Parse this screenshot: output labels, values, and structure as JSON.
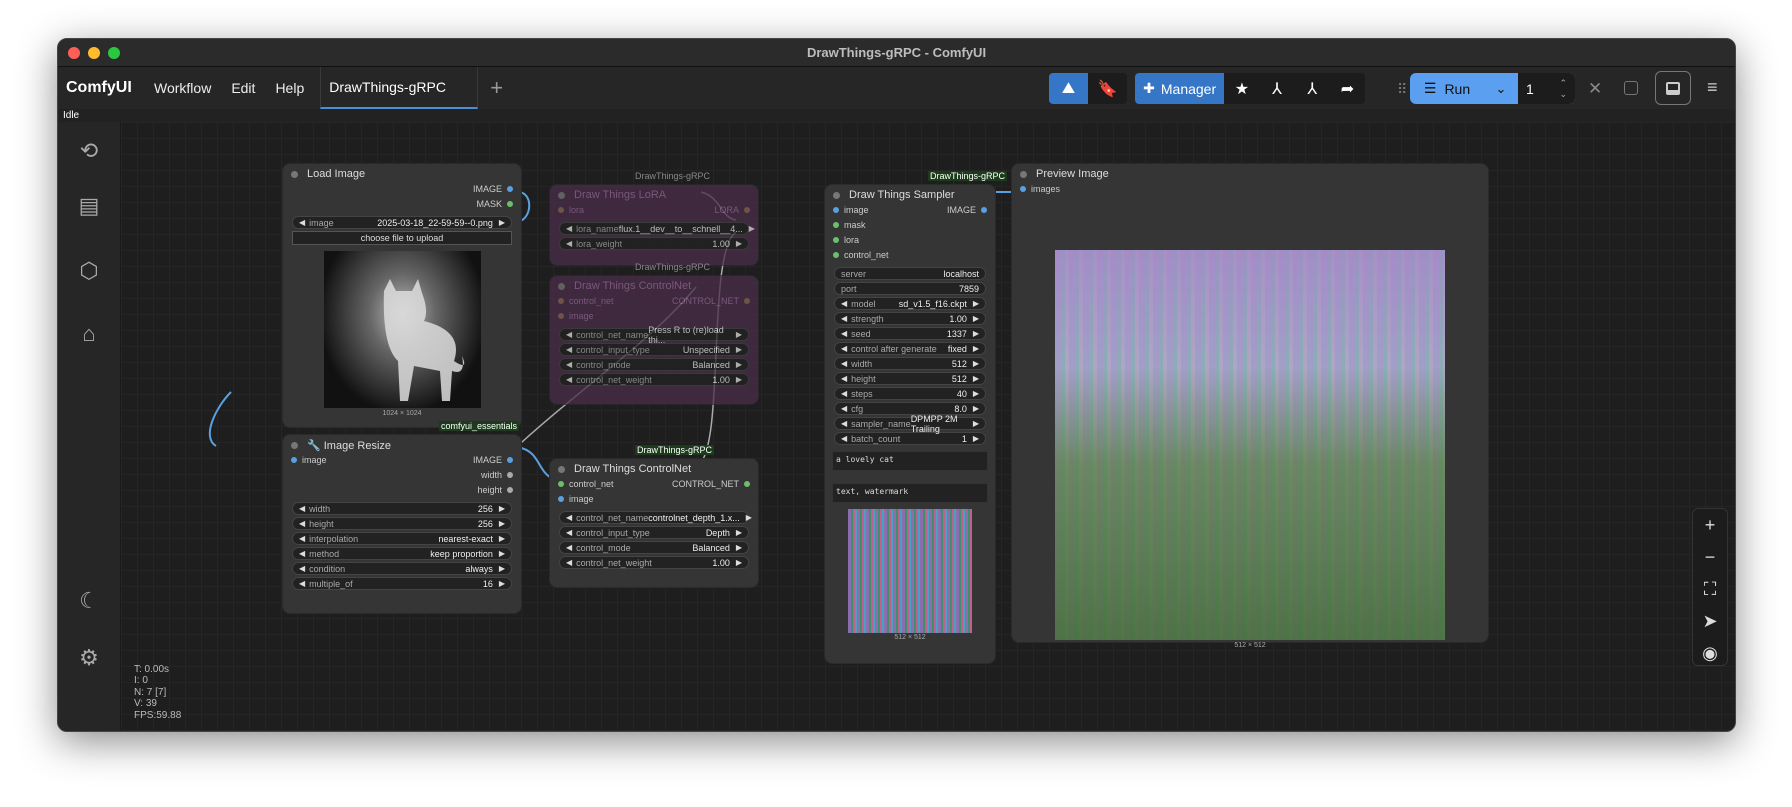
{
  "window": {
    "title": "DrawThings-gRPC - ComfyUI"
  },
  "menubar": {
    "brand": "ComfyUI",
    "items": [
      "Workflow",
      "Edit",
      "Help"
    ],
    "tab": "DrawThings-gRPC",
    "add": "+"
  },
  "toolbar": {
    "manager": "Manager",
    "run": "Run",
    "count": "1"
  },
  "status": "Idle",
  "stats": [
    "T: 0.00s",
    "I: 0",
    "N: 7 [7]",
    "V: 39",
    "FPS:59.88"
  ],
  "colors": {
    "accent": "#4a8fd6",
    "run": "#5b9ff0",
    "manager": "#3576c7"
  },
  "nodes": {
    "load_image": {
      "title": "Load Image",
      "outputs": [
        "IMAGE",
        "MASK"
      ],
      "image_label": "image",
      "image_value": "2025-03-18_22-59-59--0.png",
      "upload": "choose file to upload",
      "size": "1024 × 1024"
    },
    "resize": {
      "badge": "comfyui_essentials",
      "title": "🔧 Image Resize",
      "input": "image",
      "outputs": [
        "IMAGE",
        "width",
        "height"
      ],
      "widgets": [
        {
          "l": "width",
          "v": "256"
        },
        {
          "l": "height",
          "v": "256"
        },
        {
          "l": "interpolation",
          "v": "nearest-exact"
        },
        {
          "l": "method",
          "v": "keep proportion"
        },
        {
          "l": "condition",
          "v": "always"
        },
        {
          "l": "multiple_of",
          "v": "16"
        }
      ]
    },
    "lora": {
      "badge": "DrawThings-gRPC",
      "title": "Draw Things LoRA",
      "input": "lora",
      "output": "LORA",
      "widgets": [
        {
          "l": "lora_name",
          "v": "flux.1__dev__to__schnell__4..."
        },
        {
          "l": "lora_weight",
          "v": "1.00"
        }
      ]
    },
    "cn_faded": {
      "badge": "DrawThings-gRPC",
      "title": "Draw Things ControlNet",
      "inputs": [
        "control_net",
        "image"
      ],
      "output": "CONTROL_NET",
      "widgets": [
        {
          "l": "control_net_name",
          "v": "Press R to (re)load thi..."
        },
        {
          "l": "control_input_type",
          "v": "Unspecified"
        },
        {
          "l": "control_mode",
          "v": "Balanced"
        },
        {
          "l": "control_net_weight",
          "v": "1.00"
        }
      ]
    },
    "cn": {
      "badge": "DrawThings-gRPC",
      "title": "Draw Things ControlNet",
      "inputs": [
        "control_net",
        "image"
      ],
      "output": "CONTROL_NET",
      "widgets": [
        {
          "l": "control_net_name",
          "v": "controlnet_depth_1.x..."
        },
        {
          "l": "control_input_type",
          "v": "Depth"
        },
        {
          "l": "control_mode",
          "v": "Balanced"
        },
        {
          "l": "control_net_weight",
          "v": "1.00"
        }
      ]
    },
    "sampler": {
      "badge": "DrawThings-gRPC",
      "title": "Draw Things Sampler",
      "inputs": [
        "image",
        "mask",
        "lora",
        "control_net"
      ],
      "output": "IMAGE",
      "plain": [
        {
          "l": "server",
          "v": "localhost"
        },
        {
          "l": "port",
          "v": "7859"
        }
      ],
      "widgets": [
        {
          "l": "model",
          "v": "sd_v1.5_f16.ckpt"
        },
        {
          "l": "strength",
          "v": "1.00"
        },
        {
          "l": "seed",
          "v": "1337"
        },
        {
          "l": "control after generate",
          "v": "fixed"
        },
        {
          "l": "width",
          "v": "512"
        },
        {
          "l": "height",
          "v": "512"
        },
        {
          "l": "steps",
          "v": "40"
        },
        {
          "l": "cfg",
          "v": "8.0"
        },
        {
          "l": "sampler_name",
          "v": "DPMPP 2M Trailing"
        },
        {
          "l": "batch_count",
          "v": "1"
        }
      ],
      "positive": "a lovely cat",
      "negative": "text, watermark",
      "size": "512 × 512"
    },
    "preview": {
      "title": "Preview Image",
      "input": "images",
      "size": "512 × 512"
    }
  }
}
